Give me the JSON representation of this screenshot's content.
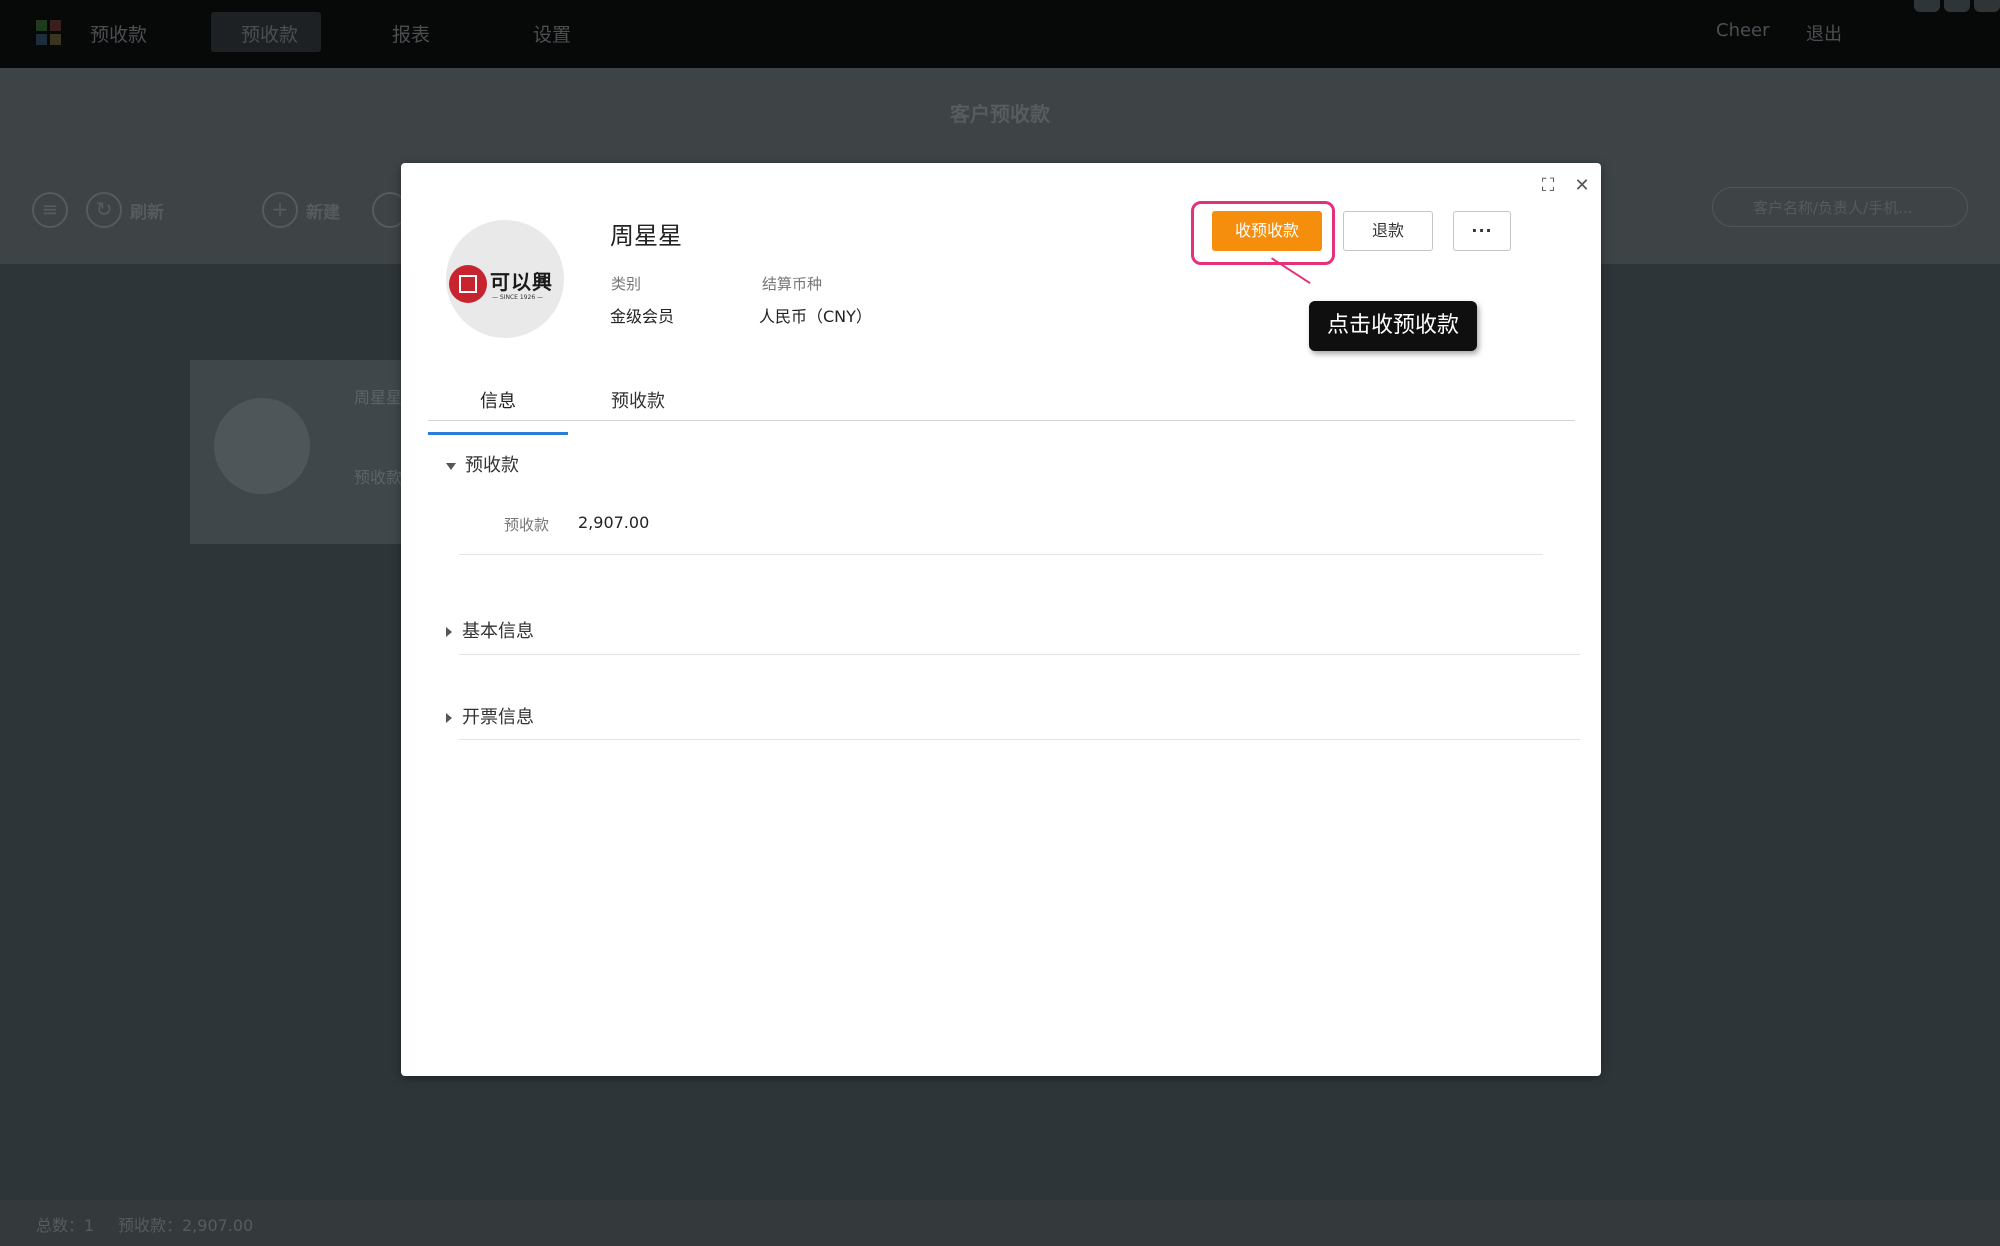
{
  "app": {
    "title": "预收款",
    "nav_tabs": [
      "预收款",
      "报表",
      "设置"
    ],
    "user": "Cheer",
    "logout": "退出"
  },
  "page": {
    "title": "客户预收款",
    "toolbar": {
      "refresh": "刷新",
      "create": "新建"
    },
    "search_placeholder": "客户名称/负责人/手机..."
  },
  "bg_card": {
    "name": "周星星",
    "field": "预收款"
  },
  "footer": {
    "total": "总数：1",
    "prepaid": "预收款：2,907.00"
  },
  "modal": {
    "customer_name": "周星星",
    "logo_text": "可以興",
    "logo_sub": "— SINCE 1926 —",
    "category_label": "类别",
    "category_value": "金级会员",
    "currency_label": "结算币种",
    "currency_value": "人民币（CNY）",
    "buttons": {
      "receive": "收预收款",
      "refund": "退款",
      "more": "···"
    },
    "tooltip": "点击收预收款",
    "tabs": [
      "信息",
      "预收款"
    ],
    "sections": {
      "prepaid": {
        "title": "预收款",
        "label": "预收款",
        "value": "2,907.00"
      },
      "basic": {
        "title": "基本信息"
      },
      "invoice": {
        "title": "开票信息"
      }
    }
  },
  "colors": {
    "primary": "#f58e0c",
    "highlight": "#e6317a",
    "tab_accent": "#2b7ed6",
    "overlay_bg": "#2e3538"
  }
}
